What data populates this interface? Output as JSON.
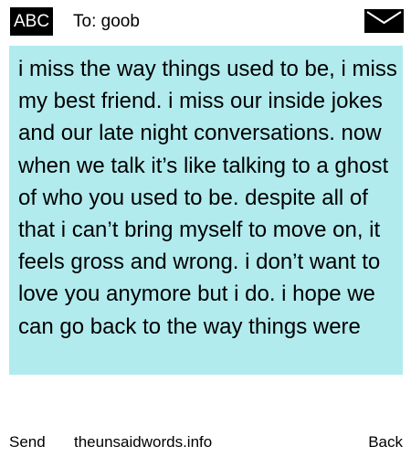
{
  "header": {
    "input_mode": "ABC",
    "recipient_label": "To: goob",
    "mail_icon": "envelope-icon"
  },
  "message": {
    "text": "i miss the way things used to be, i miss my best friend. i miss our inside jokes and our late night conversations. now when we talk it’s like talking to a ghost of who you used to be. despite all of that i can’t bring myself to move on, it feels gross and wrong. i don’t want to love you anymore but i do. i hope we can go back to the way things were"
  },
  "footer": {
    "send_label": "Send",
    "site_label": "theunsaidwords.info",
    "back_label": "Back"
  },
  "colors": {
    "message_background": "#b2ebee",
    "badge_background": "#000000",
    "text": "#000000"
  }
}
